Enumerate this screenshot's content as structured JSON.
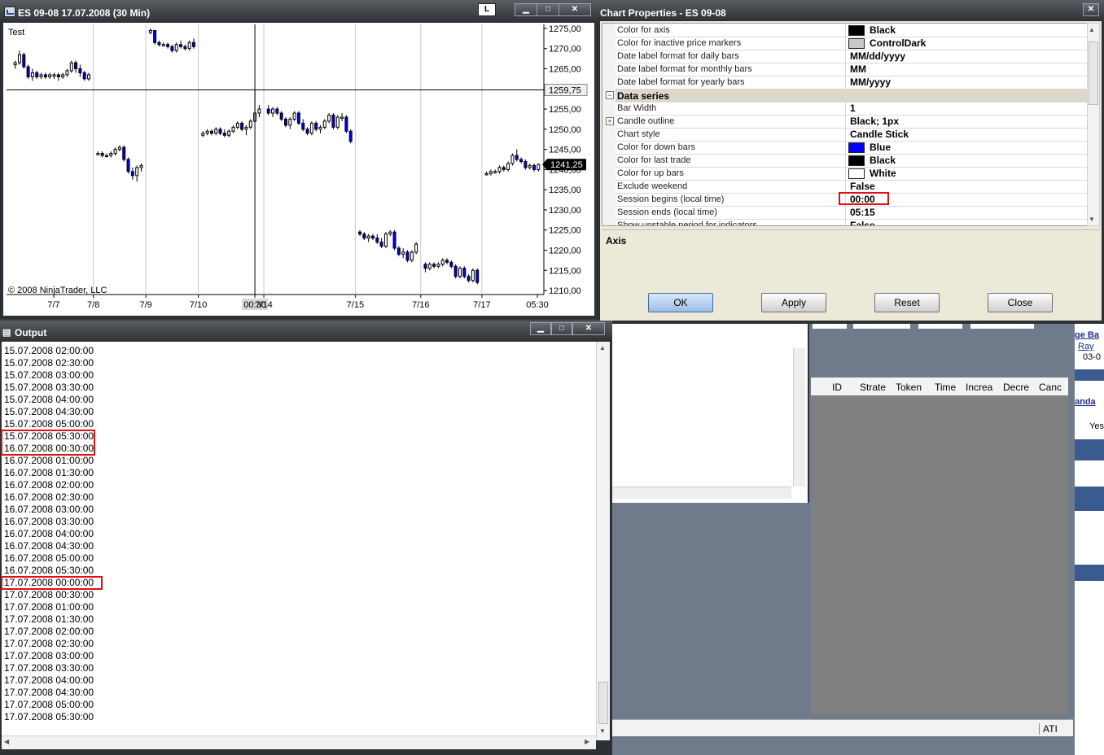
{
  "chart_window": {
    "title": "ES 09-08  17.07.2008 (30 Min)",
    "l_button": "L",
    "min_label": "▁",
    "max_label": "□",
    "close_label": "✕"
  },
  "chart_data": {
    "type": "candlestick",
    "title": "Test",
    "copyright": "© 2008 NinjaTrader, LLC",
    "y_ticks": [
      "1275,00",
      "1270,00",
      "1265,00",
      "1260,00",
      "1255,00",
      "1250,00",
      "1245,00",
      "1240,00",
      "1235,00",
      "1230,00",
      "1225,00",
      "1220,00",
      "1215,00",
      "1210,00"
    ],
    "y_values": [
      1275,
      1270,
      1265,
      1260,
      1255,
      1250,
      1245,
      1240,
      1235,
      1230,
      1225,
      1220,
      1215,
      1210
    ],
    "ylim": [
      1209,
      1276
    ],
    "x_ticks": [
      "7/7",
      "7/8",
      "7/9",
      "7/10",
      "00:30",
      "7/14",
      "7/15",
      "7/16",
      "7/17",
      "05:30"
    ],
    "crosshair_price": "1259,75",
    "crosshair_value": 1259.75,
    "last_price": "1241,25",
    "last_value": 1241.25,
    "segments": [
      {
        "day": "7/7",
        "bars": [
          [
            1266,
            1267,
            1265,
            1266.5
          ],
          [
            1266.5,
            1269.5,
            1266,
            1268.5
          ],
          [
            1268.5,
            1269,
            1265,
            1265.5
          ],
          [
            1265.5,
            1266,
            1262.5,
            1263
          ],
          [
            1263,
            1265,
            1262,
            1264
          ],
          [
            1264,
            1264.5,
            1262.5,
            1263
          ],
          [
            1263,
            1264,
            1262.5,
            1263.5
          ],
          [
            1263.5,
            1264,
            1262.5,
            1263
          ],
          [
            1263,
            1264,
            1262.5,
            1263.5
          ],
          [
            1263.5,
            1264,
            1262.5,
            1263.5
          ],
          [
            1263.5,
            1264,
            1262,
            1263
          ],
          [
            1263,
            1264,
            1262.5,
            1263.5
          ],
          [
            1263.5,
            1265,
            1263,
            1264.5
          ],
          [
            1264.5,
            1267,
            1264,
            1266.5
          ],
          [
            1266.5,
            1267,
            1264,
            1265
          ],
          [
            1265,
            1266,
            1263,
            1264
          ],
          [
            1264,
            1264.5,
            1262,
            1262.5
          ],
          [
            1262.5,
            1264,
            1262,
            1263.5
          ]
        ]
      },
      {
        "day": "7/8",
        "bars": [
          [
            1244,
            1244.5,
            1243.5,
            1244
          ],
          [
            1244,
            1244.5,
            1243,
            1243.5
          ],
          [
            1243.5,
            1244,
            1243,
            1243.5
          ],
          [
            1243.5,
            1244.5,
            1243,
            1244
          ],
          [
            1244,
            1245.5,
            1243.5,
            1245
          ],
          [
            1245,
            1246,
            1244.5,
            1245.5
          ],
          [
            1245.5,
            1246,
            1242,
            1242.5
          ],
          [
            1242.5,
            1243,
            1239,
            1239.5
          ],
          [
            1239.5,
            1240.5,
            1237.5,
            1238.5
          ],
          [
            1238.5,
            1241,
            1237,
            1240.5
          ],
          [
            1240.5,
            1241.5,
            1239.5,
            1241
          ]
        ]
      },
      {
        "day": "7/9",
        "bars": [
          [
            1274,
            1275,
            1273.5,
            1274.5
          ],
          [
            1274.5,
            1274.5,
            1271,
            1271.5
          ],
          [
            1271.5,
            1272,
            1270.5,
            1271
          ],
          [
            1271,
            1271.5,
            1270.5,
            1271
          ],
          [
            1271,
            1271.5,
            1270,
            1270.5
          ],
          [
            1270.5,
            1271,
            1269,
            1269.5
          ],
          [
            1269.5,
            1271.5,
            1269,
            1271
          ],
          [
            1271,
            1272,
            1270,
            1270.5
          ],
          [
            1270.5,
            1271,
            1269.5,
            1270
          ],
          [
            1270,
            1272,
            1269.5,
            1271.5
          ],
          [
            1271.5,
            1272.5,
            1270,
            1270.5
          ]
        ]
      },
      {
        "day": "7/10",
        "bars": [
          [
            1248.5,
            1249.5,
            1248,
            1249
          ],
          [
            1249,
            1250,
            1248.5,
            1249.5
          ],
          [
            1249.5,
            1250,
            1248.5,
            1249
          ],
          [
            1249,
            1250.5,
            1248.5,
            1250
          ],
          [
            1250,
            1250.5,
            1248.5,
            1249
          ],
          [
            1249,
            1250,
            1248,
            1248.5
          ],
          [
            1248.5,
            1250,
            1248,
            1249.5
          ],
          [
            1249.5,
            1251,
            1249,
            1250.5
          ],
          [
            1250.5,
            1252,
            1250,
            1251.5
          ],
          [
            1251.5,
            1252,
            1249.5,
            1250
          ],
          [
            1250,
            1251,
            1248.5,
            1250.5
          ],
          [
            1250.5,
            1252.5,
            1250,
            1252
          ],
          [
            1252,
            1259.5,
            1251.5,
            1254
          ],
          [
            1254,
            1256,
            1253,
            1255
          ]
        ]
      },
      {
        "day": "7/14",
        "bars": [
          [
            1255,
            1256,
            1253.5,
            1254
          ],
          [
            1254,
            1255.5,
            1253,
            1255
          ],
          [
            1255,
            1255.5,
            1253.5,
            1254
          ],
          [
            1254,
            1254.5,
            1252,
            1252.5
          ],
          [
            1252.5,
            1253,
            1250.5,
            1251
          ],
          [
            1251,
            1253,
            1250,
            1252.5
          ],
          [
            1252.5,
            1254.5,
            1252,
            1254
          ],
          [
            1254,
            1254.5,
            1251,
            1251.5
          ],
          [
            1251.5,
            1252.5,
            1249.5,
            1250
          ],
          [
            1250,
            1250.5,
            1248.5,
            1249
          ],
          [
            1249,
            1252,
            1248.5,
            1251.5
          ],
          [
            1251.5,
            1252,
            1249.5,
            1250
          ],
          [
            1250,
            1251,
            1249,
            1250.5
          ],
          [
            1250.5,
            1252.5,
            1250,
            1252
          ],
          [
            1252,
            1254,
            1251.5,
            1253.5
          ],
          [
            1253.5,
            1254,
            1250,
            1250.5
          ],
          [
            1250.5,
            1253.5,
            1250,
            1253
          ],
          [
            1253,
            1254,
            1252,
            1253
          ],
          [
            1253,
            1253.5,
            1249,
            1249.5
          ],
          [
            1249.5,
            1250,
            1246.5,
            1247
          ]
        ]
      },
      {
        "day": "7/15",
        "bars": [
          [
            1224.5,
            1225,
            1223.5,
            1224
          ],
          [
            1224,
            1224.5,
            1222.5,
            1223
          ],
          [
            1223,
            1224,
            1222,
            1223.5
          ],
          [
            1223.5,
            1224,
            1222.5,
            1223
          ],
          [
            1223,
            1224,
            1221.5,
            1222
          ],
          [
            1222,
            1223,
            1220.5,
            1221
          ],
          [
            1221,
            1224.5,
            1220.5,
            1224
          ],
          [
            1224,
            1225,
            1223.5,
            1224.5
          ],
          [
            1224.5,
            1225,
            1220,
            1220.5
          ],
          [
            1220.5,
            1221,
            1218.5,
            1219
          ],
          [
            1219,
            1220.5,
            1218,
            1219.5
          ],
          [
            1219.5,
            1220,
            1217,
            1217.5
          ],
          [
            1217.5,
            1220,
            1217,
            1219.5
          ],
          [
            1219.5,
            1222,
            1219,
            1221.5
          ]
        ]
      },
      {
        "day": "7/16",
        "bars": [
          [
            1216.5,
            1217,
            1214.5,
            1215.5
          ],
          [
            1215.5,
            1217,
            1215,
            1216.5
          ],
          [
            1216.5,
            1217,
            1215.5,
            1216
          ],
          [
            1216,
            1217,
            1215.5,
            1216.5
          ],
          [
            1216.5,
            1218,
            1216,
            1217.5
          ],
          [
            1217.5,
            1218,
            1216.5,
            1217
          ],
          [
            1217,
            1217.5,
            1215.5,
            1216
          ],
          [
            1216,
            1216.5,
            1213,
            1213.5
          ],
          [
            1213.5,
            1216,
            1213,
            1215.5
          ],
          [
            1215.5,
            1216,
            1213,
            1213.5
          ],
          [
            1213.5,
            1214,
            1212,
            1212.5
          ],
          [
            1212.5,
            1215.5,
            1212,
            1215
          ],
          [
            1215,
            1215.5,
            1211.5,
            1212
          ]
        ]
      },
      {
        "day": "7/17",
        "bars": [
          [
            1239,
            1239.5,
            1238.5,
            1239
          ],
          [
            1239,
            1240,
            1238.5,
            1239.5
          ],
          [
            1239.5,
            1240,
            1239,
            1239.5
          ],
          [
            1239.5,
            1241,
            1239,
            1240.5
          ],
          [
            1240.5,
            1241,
            1239.5,
            1240
          ],
          [
            1240,
            1242,
            1239.5,
            1241.5
          ],
          [
            1241.5,
            1244,
            1241,
            1243.5
          ],
          [
            1243.5,
            1245,
            1242,
            1242.5
          ],
          [
            1242.5,
            1243,
            1241.5,
            1242
          ],
          [
            1242,
            1242.5,
            1240,
            1240.5
          ],
          [
            1240.5,
            1241.5,
            1240,
            1241
          ],
          [
            1241,
            1241.5,
            1239.5,
            1240
          ],
          [
            1240,
            1241.5,
            1239.5,
            1241.25
          ]
        ]
      }
    ],
    "colors": {
      "up": "#ffffff",
      "down": "#0000ff",
      "outline": "#000000",
      "crosshair": "#000000",
      "grid": "#c8c8c8"
    }
  },
  "props_dialog": {
    "title": "Chart Properties - ES 09-08",
    "close_label": "✕",
    "rows": [
      {
        "name": "Color for axis",
        "value": "Black",
        "swatch": "#000000",
        "type": "prop"
      },
      {
        "name": "Color for inactive price markers",
        "value": "ControlDark",
        "swatch": "#c8c8c8",
        "type": "prop"
      },
      {
        "name": "Date label format for daily bars",
        "value": "MM/dd/yyyy",
        "type": "prop"
      },
      {
        "name": "Date label format for monthly bars",
        "value": "MM",
        "type": "prop"
      },
      {
        "name": "Date label format for yearly bars",
        "value": "MM/yyyy",
        "type": "prop"
      },
      {
        "name": "Data series",
        "value": "",
        "type": "cat"
      },
      {
        "name": "Bar Width",
        "value": "1",
        "type": "prop"
      },
      {
        "name": "Candle outline",
        "value": "Black; 1px",
        "type": "expand"
      },
      {
        "name": "Chart style",
        "value": "Candle Stick",
        "type": "prop"
      },
      {
        "name": "Color for down bars",
        "value": "Blue",
        "swatch": "#0000ff",
        "type": "prop"
      },
      {
        "name": "Color for last trade",
        "value": "Black",
        "swatch": "#000000",
        "type": "prop"
      },
      {
        "name": "Color for up bars",
        "value": "White",
        "swatch": "#ffffff",
        "type": "prop"
      },
      {
        "name": "Exclude weekend",
        "value": "False",
        "type": "prop"
      },
      {
        "name": "Session begins (local time)",
        "value": "00:00",
        "type": "prop",
        "highlight": true
      },
      {
        "name": "Session ends (local time)",
        "value": "05:15",
        "type": "prop"
      },
      {
        "name": "Show unstable period for indicators",
        "value": "False",
        "type": "prop"
      }
    ],
    "description_title": "Axis",
    "buttons": {
      "ok": "OK",
      "apply": "Apply",
      "reset": "Reset",
      "close": "Close"
    }
  },
  "output_window": {
    "title": "Output",
    "lines": [
      "15.07.2008 02:00:00",
      "15.07.2008 02:30:00",
      "15.07.2008 03:00:00",
      "15.07.2008 03:30:00",
      "15.07.2008 04:00:00",
      "15.07.2008 04:30:00",
      "15.07.2008 05:00:00",
      "15.07.2008 05:30:00",
      "16.07.2008 00:30:00",
      "16.07.2008 01:00:00",
      "16.07.2008 01:30:00",
      "16.07.2008 02:00:00",
      "16.07.2008 02:30:00",
      "16.07.2008 03:00:00",
      "16.07.2008 03:30:00",
      "16.07.2008 04:00:00",
      "16.07.2008 04:30:00",
      "16.07.2008 05:00:00",
      "16.07.2008 05:30:00",
      "17.07.2008 00:00:00",
      "17.07.2008 00:30:00",
      "17.07.2008 01:00:00",
      "17.07.2008 01:30:00",
      "17.07.2008 02:00:00",
      "17.07.2008 02:30:00",
      "17.07.2008 03:00:00",
      "17.07.2008 03:30:00",
      "17.07.2008 04:00:00",
      "17.07.2008 04:30:00",
      "17.07.2008 05:00:00",
      "17.07.2008 05:30:00"
    ],
    "highlighted_lines": [
      7,
      8,
      19
    ]
  },
  "background_app": {
    "columns": [
      "ID",
      "Strate",
      "Token",
      "Time",
      "Increa",
      "Decre",
      "Canc"
    ],
    "side_texts": [
      "ge Ba",
      "Ray",
      "03-0",
      "anda",
      "Yes"
    ],
    "status": "ATI"
  }
}
